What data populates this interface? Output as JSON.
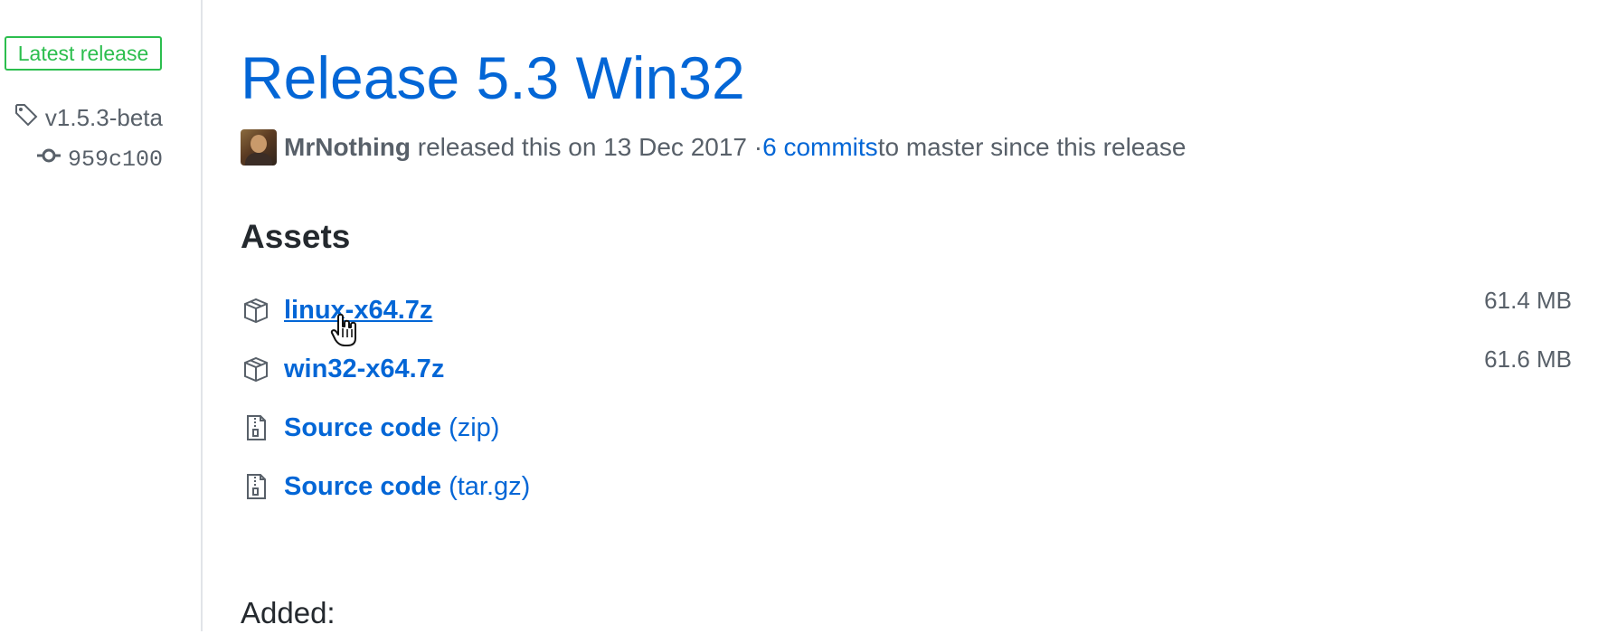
{
  "sidebar": {
    "badge": "Latest release",
    "tag": "v1.5.3-beta",
    "commit": "959c100",
    "icons": {
      "tag": "tag-icon",
      "commit": "git-commit-icon"
    }
  },
  "release": {
    "title": "Release 5.3 Win32",
    "author": "MrNothing",
    "released_text": "released this on 13 Dec 2017 · ",
    "commits_link": "6 commits",
    "since_text": " to master since this release"
  },
  "assets": {
    "heading": "Assets",
    "items": [
      {
        "label": "linux-x64.7z",
        "suffix": "",
        "size": "61.4 MB",
        "icon": "package-icon",
        "hovered": true
      },
      {
        "label": "win32-x64.7z",
        "suffix": "",
        "size": "61.6 MB",
        "icon": "package-icon",
        "hovered": false
      },
      {
        "label": "Source code",
        "suffix": "(zip)",
        "size": "",
        "icon": "file-zip-icon",
        "hovered": false
      },
      {
        "label": "Source code",
        "suffix": "(tar.gz)",
        "size": "",
        "icon": "file-zip-icon",
        "hovered": false
      }
    ]
  },
  "notes": {
    "added_heading": "Added:"
  },
  "colors": {
    "link": "#0366d6",
    "badge_green": "#2cbe4e",
    "muted": "#586069",
    "text": "#24292e",
    "border": "#e1e4e8"
  }
}
